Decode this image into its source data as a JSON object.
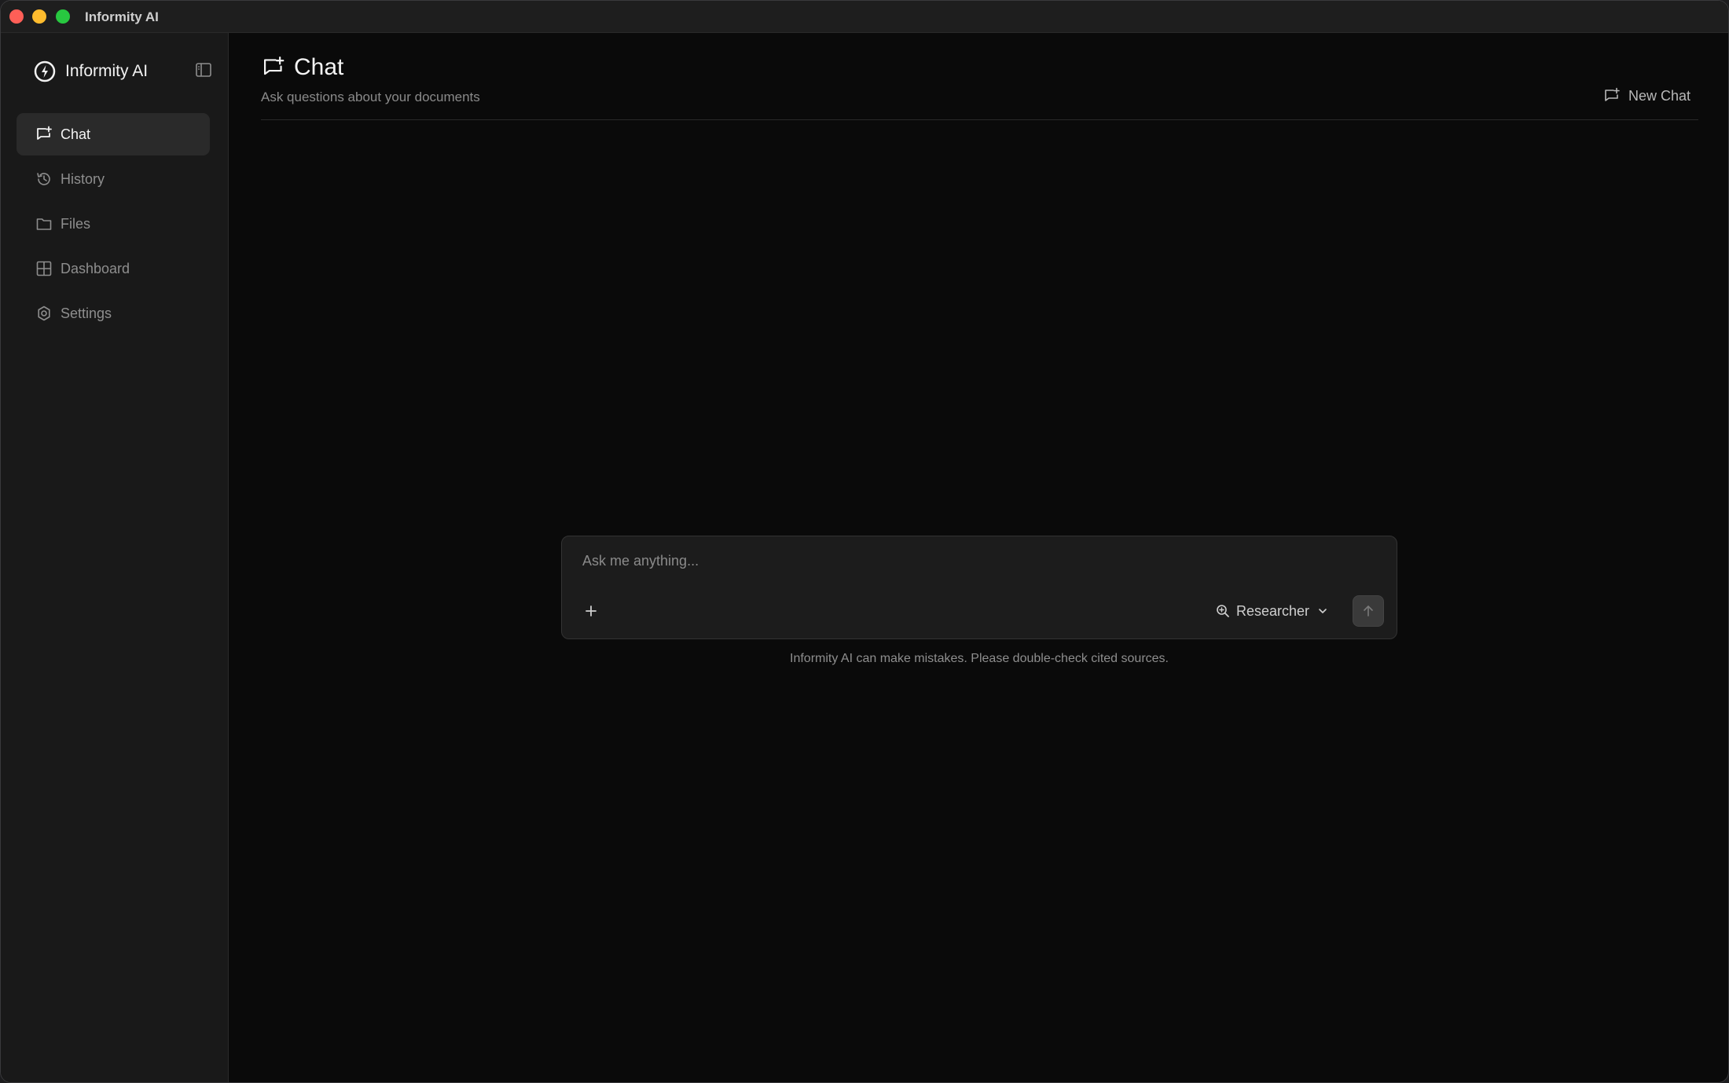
{
  "window": {
    "title": "Informity AI"
  },
  "sidebar": {
    "brand": "Informity AI",
    "items": [
      {
        "label": "Chat",
        "icon": "chat-plus-icon",
        "active": true
      },
      {
        "label": "History",
        "icon": "history-icon",
        "active": false
      },
      {
        "label": "Files",
        "icon": "folder-icon",
        "active": false
      },
      {
        "label": "Dashboard",
        "icon": "grid-icon",
        "active": false
      },
      {
        "label": "Settings",
        "icon": "gear-icon",
        "active": false
      }
    ]
  },
  "header": {
    "title": "Chat",
    "subtitle": "Ask questions about your documents",
    "new_chat_label": "New Chat"
  },
  "composer": {
    "placeholder": "Ask me anything...",
    "value": "",
    "mode": "Researcher"
  },
  "disclaimer": "Informity AI can make mistakes. Please double-check cited sources.",
  "colors": {
    "background": "#0a0a0a",
    "sidebar": "#191919",
    "active_item": "#2a2a2a",
    "text_primary": "#f2f2f2",
    "text_muted": "#8e8e8e"
  }
}
